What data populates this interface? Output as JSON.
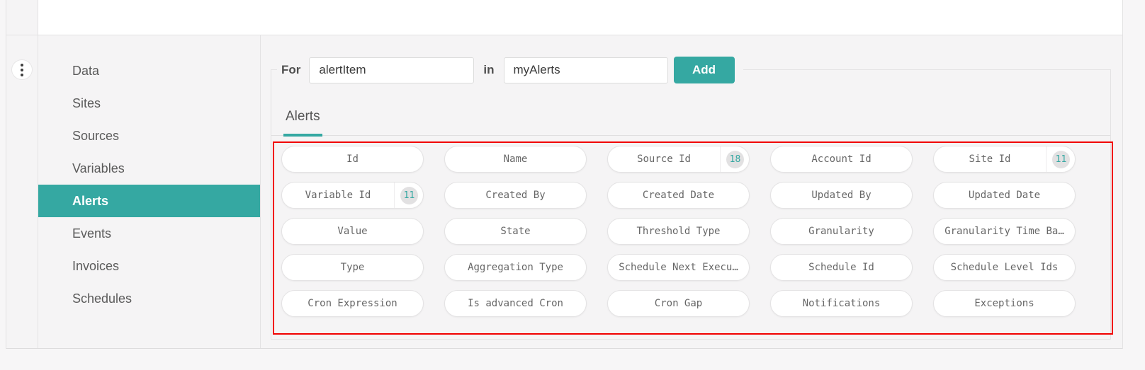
{
  "colors": {
    "teal": "#35a8a2",
    "highlight_red": "#f10000"
  },
  "rail": {
    "menu_icon": "vertical-kebab"
  },
  "sidebar": {
    "items": [
      {
        "label": "Data",
        "active": false
      },
      {
        "label": "Sites",
        "active": false
      },
      {
        "label": "Sources",
        "active": false
      },
      {
        "label": "Variables",
        "active": false
      },
      {
        "label": "Alerts",
        "active": true
      },
      {
        "label": "Events",
        "active": false
      },
      {
        "label": "Invoices",
        "active": false
      },
      {
        "label": "Schedules",
        "active": false
      }
    ]
  },
  "iterator_form": {
    "for_label": "For",
    "item_input": {
      "value": "alertItem"
    },
    "in_label": "in",
    "collection_input": {
      "value": "myAlerts"
    },
    "add_button": "Add"
  },
  "tabs": {
    "active_tab": "Alerts"
  },
  "fields": [
    {
      "label": "Id",
      "badge": null
    },
    {
      "label": "Name",
      "badge": null
    },
    {
      "label": "Source Id",
      "badge": "18"
    },
    {
      "label": "Account Id",
      "badge": null
    },
    {
      "label": "Site Id",
      "badge": "11"
    },
    {
      "label": "Variable Id",
      "badge": "11"
    },
    {
      "label": "Created By",
      "badge": null
    },
    {
      "label": "Created Date",
      "badge": null
    },
    {
      "label": "Updated By",
      "badge": null
    },
    {
      "label": "Updated Date",
      "badge": null
    },
    {
      "label": "Value",
      "badge": null
    },
    {
      "label": "State",
      "badge": null
    },
    {
      "label": "Threshold Type",
      "badge": null
    },
    {
      "label": "Granularity",
      "badge": null
    },
    {
      "label": "Granularity Time Ba…",
      "badge": null
    },
    {
      "label": "Type",
      "badge": null
    },
    {
      "label": "Aggregation Type",
      "badge": null
    },
    {
      "label": "Schedule Next Execu…",
      "badge": null
    },
    {
      "label": "Schedule Id",
      "badge": null
    },
    {
      "label": "Schedule Level Ids",
      "badge": null
    },
    {
      "label": "Cron Expression",
      "badge": null
    },
    {
      "label": "Is advanced Cron",
      "badge": null
    },
    {
      "label": "Cron Gap",
      "badge": null
    },
    {
      "label": "Notifications",
      "badge": null
    },
    {
      "label": "Exceptions",
      "badge": null
    }
  ]
}
